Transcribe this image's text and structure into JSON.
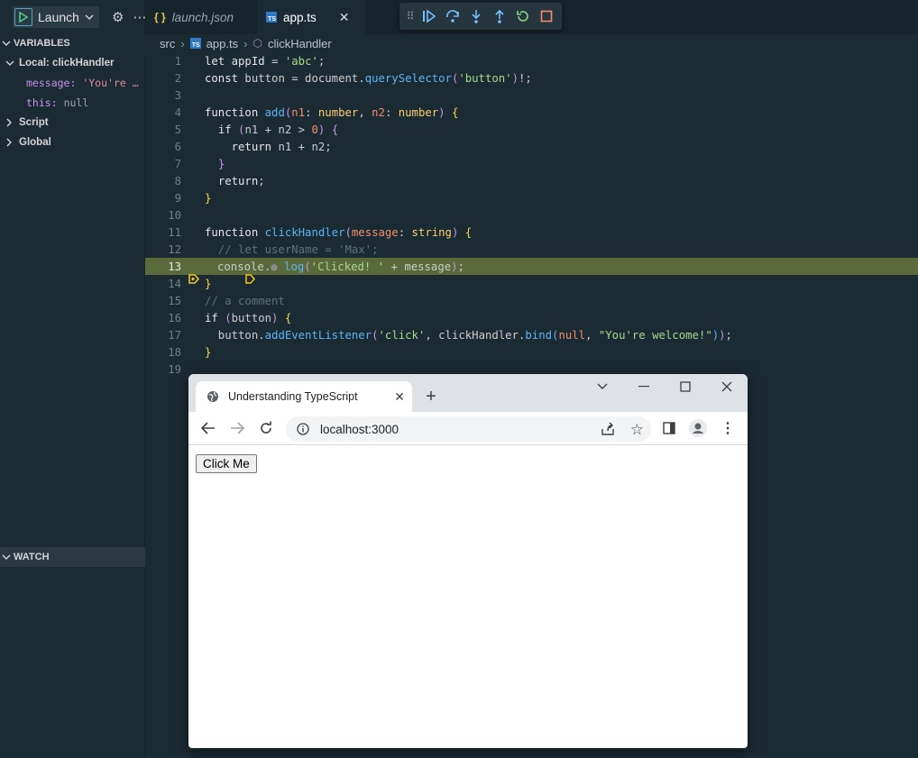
{
  "run": {
    "config_label": "Launch"
  },
  "sidebar": {
    "variables_header": "VARIABLES",
    "local_scope": "Local: clickHandler",
    "vars": [
      {
        "name": "message:",
        "value": "'You're …"
      },
      {
        "name": "this:",
        "value": "null"
      }
    ],
    "script_scope": "Script",
    "global_scope": "Global",
    "watch_header": "WATCH"
  },
  "tabs": [
    {
      "icon_text": "{ }",
      "label": "launch.json"
    },
    {
      "icon_text": "TS",
      "label": "app.ts"
    }
  ],
  "breadcrumb": {
    "folder": "src",
    "file": "app.ts",
    "symbol": "clickHandler"
  },
  "editor": {
    "current_line": 13,
    "lines": [
      {
        "n": "1"
      },
      {
        "n": "2"
      },
      {
        "n": "3"
      },
      {
        "n": "4"
      },
      {
        "n": "5"
      },
      {
        "n": "6"
      },
      {
        "n": "7"
      },
      {
        "n": "8"
      },
      {
        "n": "9"
      },
      {
        "n": "10"
      },
      {
        "n": "11"
      },
      {
        "n": "12"
      },
      {
        "n": "13"
      },
      {
        "n": "14"
      },
      {
        "n": "15"
      },
      {
        "n": "16"
      },
      {
        "n": "17"
      },
      {
        "n": "18"
      },
      {
        "n": "19"
      }
    ]
  },
  "browser": {
    "tab_title": "Understanding TypeScript",
    "url": "localhost:3000",
    "button_label": "Click Me"
  },
  "colors": {
    "editor_bg": "#1b2b34",
    "current_line_bg": "#5b6a3a",
    "breakpoint": "#f5c518",
    "ts_blue": "#3178c6"
  }
}
